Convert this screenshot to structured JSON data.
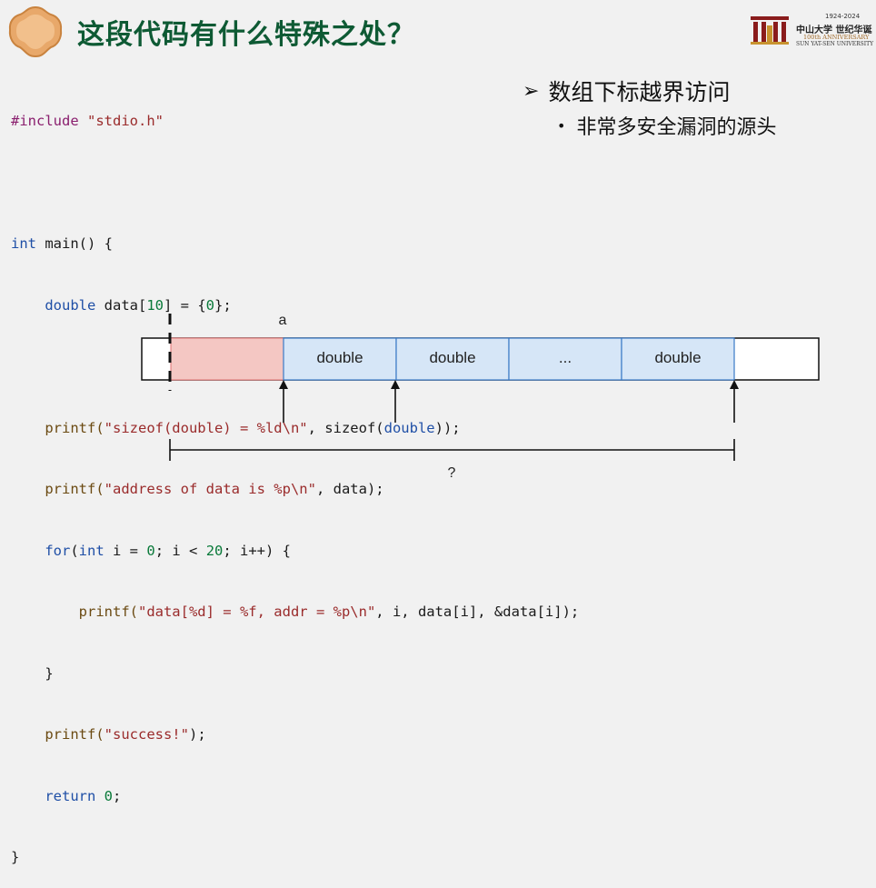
{
  "slide": {
    "title": "这段代码有什么特殊之处？",
    "university": {
      "years": "1924-2024",
      "name": "中山大学 世纪华诞",
      "anniversary": "100th ANNIVERSARY",
      "english": "SUN YAT-SEN UNIVERSITY"
    }
  },
  "code": {
    "l1": {
      "a": "#include",
      "b": " ",
      "c": "\"stdio.h\""
    },
    "l3": {
      "a": "int",
      "b": " main() {"
    },
    "l4": {
      "a": "    double",
      "b": " data[",
      "c": "10",
      "d": "] = {",
      "e": "0",
      "f": "};"
    },
    "l6": {
      "a": "    printf(",
      "b": "\"sizeof(double) = %ld\\n\"",
      "c": ", sizeof(",
      "d": "double",
      "e": "));"
    },
    "l7": {
      "a": "    printf(",
      "b": "\"address of data is %p\\n\"",
      "c": ", data);"
    },
    "l8": {
      "a": "    for",
      "b": "(",
      "c": "int",
      "d": " i = ",
      "e": "0",
      "f": "; i < ",
      "g": "20",
      "h": "; i++) {"
    },
    "l9": {
      "a": "        printf(",
      "b": "\"data[%d] = %f, addr = %p\\n\"",
      "c": ", i, data[i], &data[i]);"
    },
    "l10": {
      "a": "    }"
    },
    "l11": {
      "a": "    printf(",
      "b": "\"success!\"",
      "c": ");"
    },
    "l12": {
      "a": "    return",
      "b": " ",
      "c": "0",
      "d": ";"
    },
    "l13": {
      "a": "}"
    }
  },
  "bullets": {
    "main": "数组下标越界访问",
    "sub": "非常多安全漏洞的源头"
  },
  "diagram": {
    "pointer_label": "a",
    "cells": [
      "",
      "double",
      "double",
      "...",
      "double",
      ""
    ],
    "span_label": "?",
    "colors": {
      "highlight": "#f4c7c3",
      "array": "#d6e6f7",
      "border": "#3a7ac6",
      "outline": "#111111"
    }
  }
}
